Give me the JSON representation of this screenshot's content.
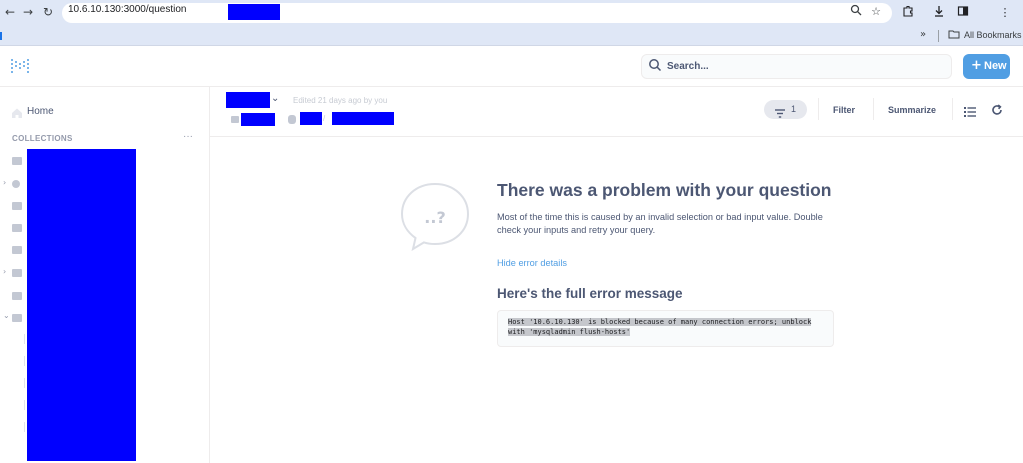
{
  "browser": {
    "url": "10.6.10.130:3000/question",
    "bookmarks_overflow": "»",
    "bookmarks_folder": "All Bookmarks"
  },
  "header": {
    "search_placeholder": "Search...",
    "new_label": "New",
    "new_icon": "+"
  },
  "sidebar": {
    "home_label": "Home",
    "collections_label": "COLLECTIONS",
    "more_label": "···"
  },
  "question": {
    "edited_text": "Edited 21 days ago by you",
    "filter_count": "1",
    "filter_label": "Filter",
    "summarize_label": "Summarize"
  },
  "error": {
    "bubble_text": "..?",
    "title": "There was a problem with your question",
    "description": "Most of the time this is caused by an invalid selection or bad input value. Double check your inputs and retry your query.",
    "hide_link": "Hide error details",
    "full_title": "Here's the full error message",
    "message_line1": "Host '10.6.10.130' is blocked because of many connection errors; unblock",
    "message_line2": "with 'mysqladmin flush-hosts'"
  },
  "colors": {
    "brand": "#509ee3",
    "text": "#4c5773",
    "redaction": "#0000ff"
  }
}
